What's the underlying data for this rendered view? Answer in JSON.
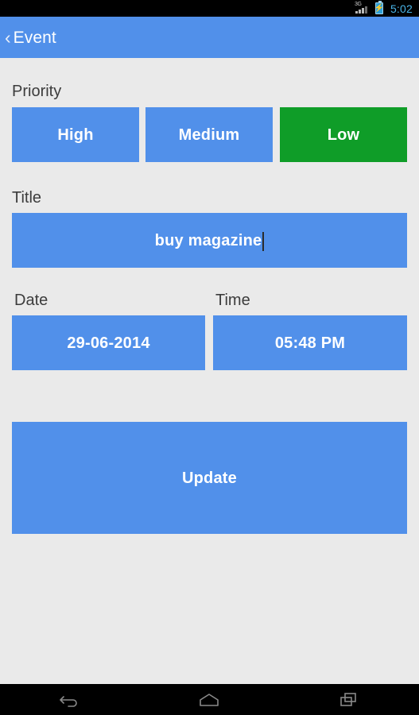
{
  "status_bar": {
    "network_label": "3G",
    "signal_icon": "signal-bars-icon",
    "battery_icon": "battery-charging-icon",
    "time": "5:02",
    "time_color": "#49b4e8"
  },
  "action_bar": {
    "back_icon": "‹",
    "title": "Event",
    "background_color": "#5190ea"
  },
  "form": {
    "priority": {
      "label": "Priority",
      "options": [
        {
          "label": "High",
          "selected": false
        },
        {
          "label": "Medium",
          "selected": false
        },
        {
          "label": "Low",
          "selected": true
        }
      ],
      "selected_value": "Low",
      "unselected_color": "#5190ea",
      "selected_color": "#0f9d28"
    },
    "title": {
      "label": "Title",
      "value": "buy magazine",
      "placeholder": "Title",
      "focused": true
    },
    "date": {
      "label": "Date",
      "value": "29-06-2014"
    },
    "time": {
      "label": "Time",
      "value": "05:48 PM"
    },
    "submit": {
      "label": "Update"
    }
  },
  "nav_bar": {
    "buttons": [
      {
        "name": "back",
        "icon": "back-arrow-icon"
      },
      {
        "name": "home",
        "icon": "home-icon"
      },
      {
        "name": "recents",
        "icon": "recents-icon"
      }
    ]
  },
  "theme": {
    "page_background": "#eaeaea",
    "accent_blue": "#5190ea",
    "accent_green": "#0f9d28",
    "label_color": "#3c3c3c"
  }
}
